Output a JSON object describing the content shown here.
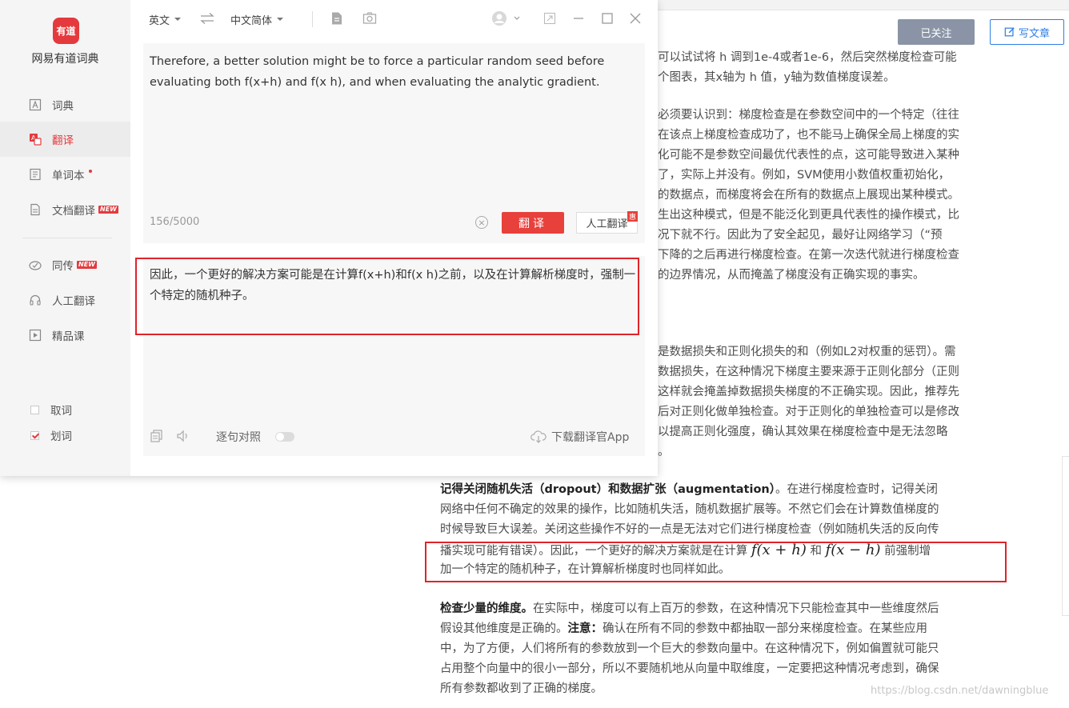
{
  "blog": {
    "follow_label": "已关注",
    "write_label": "写文章",
    "section1": [
      "可以试试将 h 调到1e-4或者1e-6，然后突然梯度检查可能",
      "个图表，其x轴为 h 值，y轴为数值梯度误差。"
    ],
    "section2": [
      "必须要认识到：梯度检查是在参数空间中的一个特定（往往",
      "在该点上梯度检查成功了，也不能马上确保全局上梯度的实",
      "化可能不是参数空间最优代表性的点，这可能导致进入某种",
      "了，实际上并没有。例如，SVM使用小数值权重初始化，",
      "的数据点，而梯度将会在所有的数据点上展现出某种模式。",
      "生出这种模式，但是不能泛化到更具代表性的操作模式，比",
      "况下就不行。因此为了安全起见，最好让网络学习（“预",
      "下降的之后再进行梯度检查。在第一次迭代就进行梯度检查",
      "的边界情况，从而掩盖了梯度没有正确实现的事实。"
    ],
    "section3": [
      "是数据损失和正则化损失的和（例如L2对权重的惩罚）。需",
      "数据损失，在这种情况下梯度主要来源于正则化部分（正则",
      "这样就会掩盖掉数据损失梯度的不正确实现。因此，推荐先",
      "后对正则化做单独检查。对于正则化的单独检查可以是修改",
      "以提高正则化强度，确认其效果在梯度检查中是无法忽略",
      "。"
    ],
    "p1": {
      "title": "记得关闭随机失活（dropout）和数据扩张（augmentation）",
      "l1_rest": "。在进行梯度检查时，记得关闭",
      "l2": "网络中任何不确定的效果的操作，比如随机失活，随机数据扩展等。不然它们会在计算数值梯度的",
      "l3": "时候导致巨大误差。关闭这些操作不好的一点是无法对它们进行梯度检查（例如随机失活的反向传",
      "l4a": "播实现可能有错误）。因此，一个更好的解决方案就是在计算",
      "math1": "f(x + h)",
      "l4b": "和",
      "math2": "f(x − h)",
      "l4c": "前强制增",
      "l5": "加一个特定的随机种子，在计算解析梯度时也同样如此。"
    },
    "p2": {
      "title": "检查少量的维度。",
      "l1_rest": "在实际中，梯度可以有上百万的参数，在这种情况下只能检查其中一些维度然后",
      "l2a": "假设其他维度是正确的。",
      "l2_bold": "注意：",
      "l2b": "确认在所有不同的参数中都抽取一部分来梯度检查。在某些应用",
      "l3": "中，为了方便，人们将所有的参数放到一个巨大的参数向量中。在这种情况下，例如偏置就可能只",
      "l4": "占用整个向量中的很小一部分，所以不要随机地从向量中取维度，一定要把这种情况考虑到，确保",
      "l5": "所有参数都收到了正确的梯度。"
    },
    "watermark": "https://blog.csdn.net/dawningblue"
  },
  "youdao": {
    "logo_text": "有道",
    "app_name": "网易有道词典",
    "nav": {
      "dict": "词典",
      "translate": "翻译",
      "wordbook": "单词本",
      "doc_translate": "文档翻译",
      "simul": "同传",
      "human": "人工翻译",
      "courses": "精品课"
    },
    "new_badge": "NEW",
    "options": {
      "pick_word": "取词",
      "select_word": "划词"
    },
    "source_lang": "英文",
    "target_lang": "中文简体",
    "source_text": "Therefore, a better solution might be to force a particular random seed before evaluating both f(x+h) and f(x h), and when evaluating the analytic gradient.",
    "char_count": "156/5000",
    "translate_btn": "翻译",
    "human_btn": "人工翻译",
    "hui_badge": "惠",
    "result_text": "因此，一个更好的解决方案可能是在计算f(x+h)和f(x    h)之前，以及在计算解析梯度时，强制一个特定的随机种子。",
    "sentence_compare": "逐句对照",
    "download_app": "下载翻译官App"
  },
  "colors": {
    "brand_red": "#e43a3e",
    "highlight_red": "#e0242a",
    "link_blue": "#2f7fe5"
  }
}
